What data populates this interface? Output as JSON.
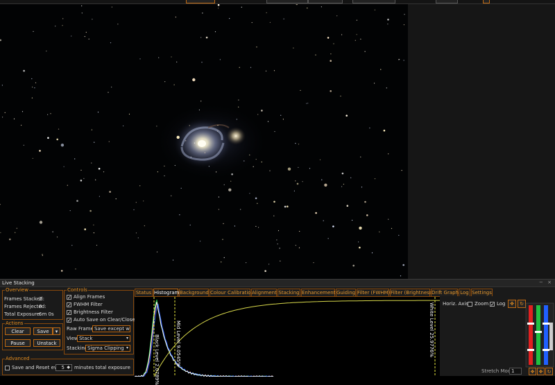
{
  "panel": {
    "title": "Live Stacking",
    "window_buttons": "− ×"
  },
  "overview": {
    "title": "Overview",
    "frames_stacked_label": "Frames Stacked:",
    "frames_stacked_value": "2",
    "frames_rejected_label": "Frames Rejected:",
    "frames_rejected_value": "0",
    "total_exposure_label": "Total Exposure:",
    "total_exposure_value": "6m 0s"
  },
  "actions": {
    "title": "Actions",
    "clear": "Clear",
    "save": "Save",
    "pause": "Pause",
    "unstack": "Unstack"
  },
  "controls": {
    "title": "Controls",
    "align_frames": {
      "label": "Align Frames",
      "checked": true
    },
    "fwhm_filter": {
      "label": "FWHM Filter",
      "checked": true
    },
    "brightness_filter": {
      "label": "Brightness Filter",
      "checked": true
    },
    "auto_save": {
      "label": "Auto Save on Clear/Close",
      "checked": true
    },
    "raw_frames_label": "Raw Frames",
    "raw_frames_value": "Save except w",
    "view_label": "View",
    "view_value": "Stack",
    "stacking_label": "Stacking",
    "stacking_value": "Sigma Clipping"
  },
  "advanced": {
    "title": "Advanced",
    "save_reset_label": "Save and Reset every",
    "save_reset_value": "5",
    "save_reset_suffix": "minutes total exposure"
  },
  "tabs": [
    "Status",
    "Histogram",
    "Background",
    "Colour Calibration",
    "Alignment",
    "Stacking",
    "Enhancement",
    "Guiding",
    "Filter (FWHM)",
    "Filter (Brightness)",
    "Drift Graph",
    "Log",
    "Settings"
  ],
  "active_tab": "Histogram",
  "histogram": {
    "black_level": "Black Level 2.0789%",
    "mid_level": "Mid Level 9.0545%",
    "white_level": "White Level 25.9776%",
    "horiz_axis_label": "Horiz. Axis:",
    "zoom_label": "Zoom",
    "zoom_checked": false,
    "log_label": "Log",
    "log_checked": true,
    "stretch_mode_label": "Stretch Mode",
    "stretch_mode_value": "1"
  },
  "colors": {
    "accent": "#c06a12",
    "accent_text": "#e88f1f",
    "red": "#e02020",
    "green": "#20c040",
    "blue": "#2060ff",
    "curve": "#d8d84a"
  }
}
